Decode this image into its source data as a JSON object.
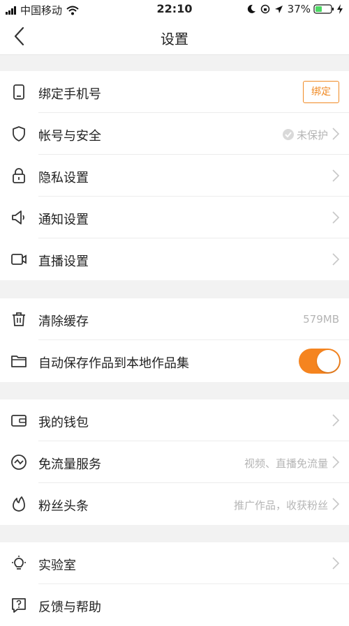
{
  "status_bar": {
    "carrier": "中国移动",
    "time": "22:10",
    "battery": "37%"
  },
  "header": {
    "title": "设置"
  },
  "groups": [
    {
      "items": [
        {
          "label": "绑定手机号",
          "action_label": "绑定",
          "icon": "phone-icon"
        },
        {
          "label": "帐号与安全",
          "value": "未保护",
          "icon": "shield-icon"
        },
        {
          "label": "隐私设置",
          "icon": "lock-icon"
        },
        {
          "label": "通知设置",
          "icon": "speaker-icon"
        },
        {
          "label": "直播设置",
          "icon": "video-camera-icon"
        }
      ]
    },
    {
      "items": [
        {
          "label": "清除缓存",
          "value": "579MB",
          "icon": "trash-icon"
        },
        {
          "label": "自动保存作品到本地作品集",
          "toggle_on": true,
          "icon": "folder-icon"
        }
      ]
    },
    {
      "items": [
        {
          "label": "我的钱包",
          "icon": "wallet-icon"
        },
        {
          "label": "免流量服务",
          "value": "视频、直播免流量",
          "icon": "pulse-circle-icon"
        },
        {
          "label": "粉丝头条",
          "value": "推广作品，收获粉丝",
          "icon": "flame-icon"
        }
      ]
    },
    {
      "items": [
        {
          "label": "实验室",
          "icon": "lightbulb-icon"
        },
        {
          "label": "反馈与帮助",
          "icon": "help-icon"
        }
      ]
    }
  ],
  "colors": {
    "accent": "#f5841f",
    "background": "#f2f2f2"
  }
}
